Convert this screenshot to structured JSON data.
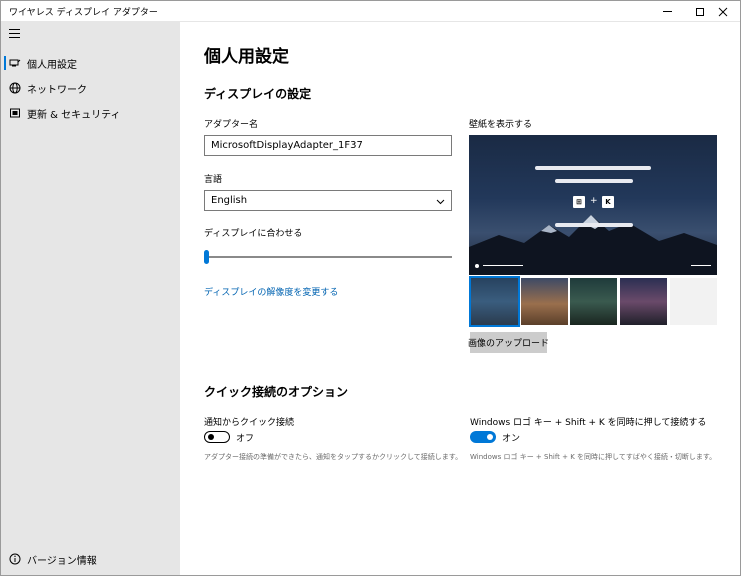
{
  "window": {
    "title": "ワイヤレス ディスプレイ アダプター"
  },
  "sidebar": {
    "items": [
      {
        "label": "個人用設定",
        "icon": "personalize-icon",
        "selected": true
      },
      {
        "label": "ネットワーク",
        "icon": "globe-icon"
      },
      {
        "label": "更新 & セキュリティ",
        "icon": "update-icon"
      }
    ],
    "footer": {
      "label": "バージョン情報",
      "icon": "info-icon"
    }
  },
  "main": {
    "page_title": "個人用設定",
    "display_section": {
      "title": "ディスプレイの設定",
      "adapter_name_label": "アダプター名",
      "adapter_name_value": "MicrosoftDisplayAdapter_1F37",
      "language_label": "言語",
      "language_value": "English",
      "fit_label": "ディスプレイに合わせる",
      "fit_slider_value": 0.0,
      "resolution_link": "ディスプレイの解像度を変更する"
    },
    "wallpaper": {
      "label": "壁紙を表示する",
      "preview_keys": [
        "⊞",
        "+",
        "K"
      ],
      "upload_button": "画像のアップロード"
    },
    "quick_connect": {
      "title": "クイック接続のオプション",
      "notify": {
        "label": "通知からクイック接続",
        "state": "オフ",
        "on": false,
        "desc": "アダプター接続の準備ができたら、通知をタップするかクリックして接続します。"
      },
      "hotkey": {
        "label": "Windows ロゴ キー + Shift + K を同時に押して接続する",
        "state": "オン",
        "on": true,
        "desc": "Windows ロゴ キー + Shift + K を同時に押してすばやく接続・切断します。"
      }
    }
  },
  "colors": {
    "accent": "#0078d7",
    "sidebar_bg": "#e6e6e6",
    "link": "#0063b1"
  }
}
